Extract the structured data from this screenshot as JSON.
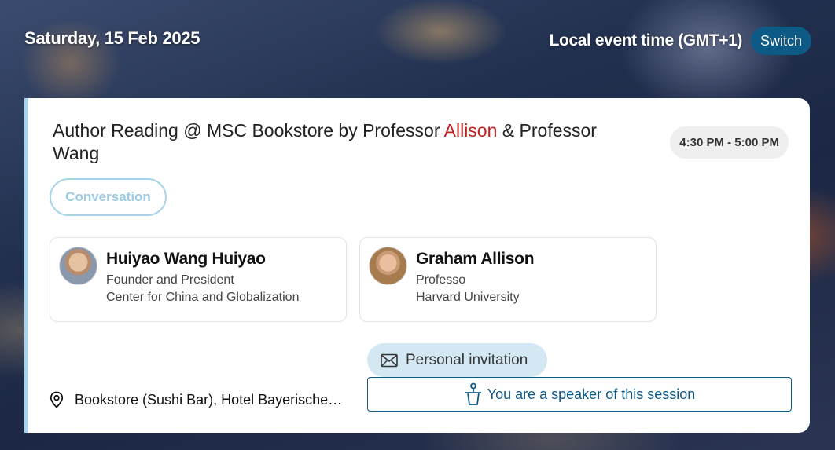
{
  "header": {
    "date": "Saturday, 15 Feb 2025",
    "timezone_label": "Local event time (GMT+1)",
    "switch_label": "Switch"
  },
  "session": {
    "title_before": "Author Reading @ MSC Bookstore by Professor ",
    "title_highlight": "Allison",
    "title_after": " & Professor Wang",
    "time": "4:30 PM - 5:00 PM",
    "tag": "Conversation",
    "speakers": [
      {
        "name": "Huiyao Wang Huiyao",
        "role": "Founder and President",
        "org": "Center for China and Globalization"
      },
      {
        "name": "Graham Allison",
        "role": "Professo",
        "org": "Harvard University"
      }
    ],
    "invitation_label": "Personal invitation",
    "location": "Bookstore (Sushi Bar), Hotel Bayerischer Hof",
    "speaker_button_label": "You are a speaker of this session"
  },
  "colors": {
    "accent": "#0e5a86",
    "highlight": "#c0201e",
    "tag_border": "#a8d3ea",
    "invite_bg": "#d4e8f4"
  },
  "icons": {
    "invitation": "envelope-icon",
    "location": "map-pin-icon",
    "speaker": "speaker-podium-icon"
  }
}
